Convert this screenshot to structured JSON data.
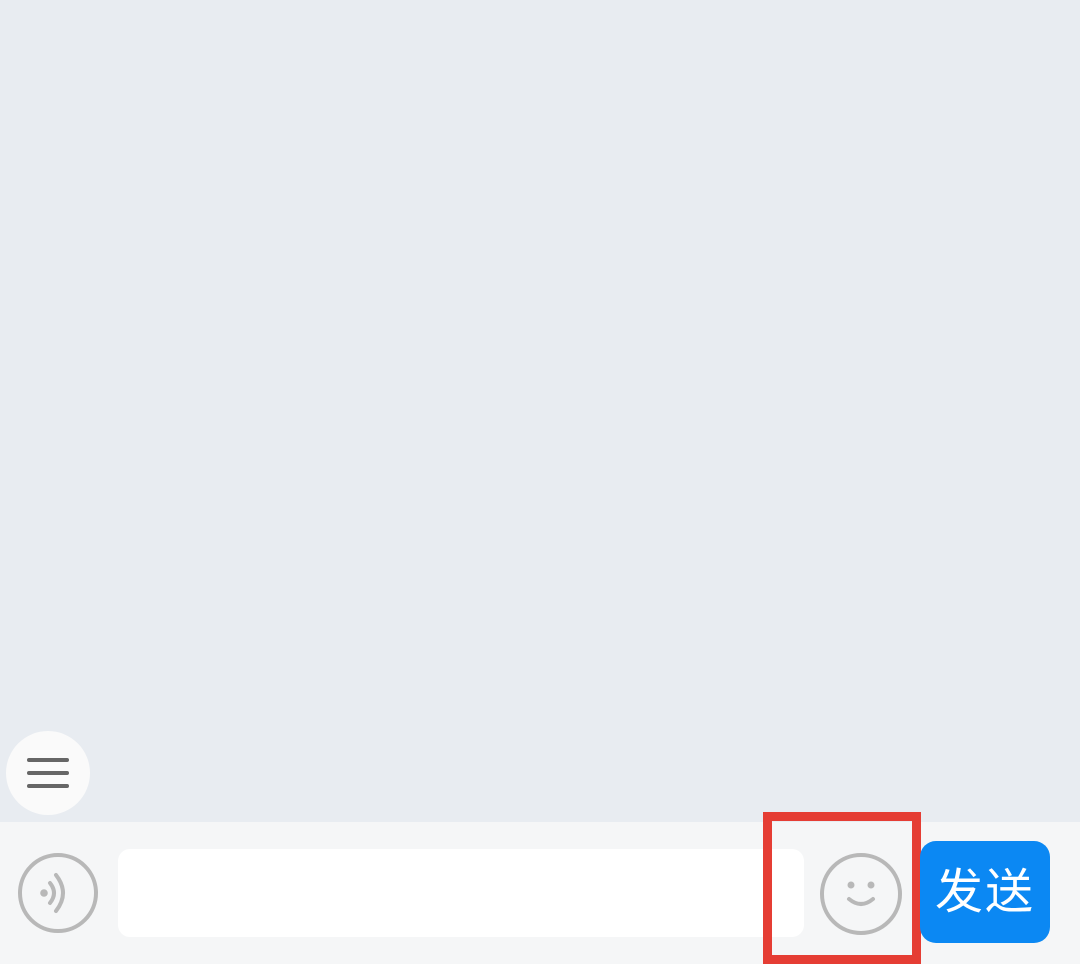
{
  "chat": {
    "menu_icon": "hamburger-menu-icon"
  },
  "composer": {
    "voice_icon": "voice-sound-icon",
    "message_value": "",
    "message_placeholder": "",
    "emoji_icon": "smiley-face-icon",
    "send_label": "发送"
  },
  "colors": {
    "background": "#e8ecf1",
    "input_bar": "#f5f6f7",
    "input_field": "#ffffff",
    "icon_gray": "#b8b8b8",
    "send_button": "#0b88f3",
    "highlight": "#e53d34"
  }
}
